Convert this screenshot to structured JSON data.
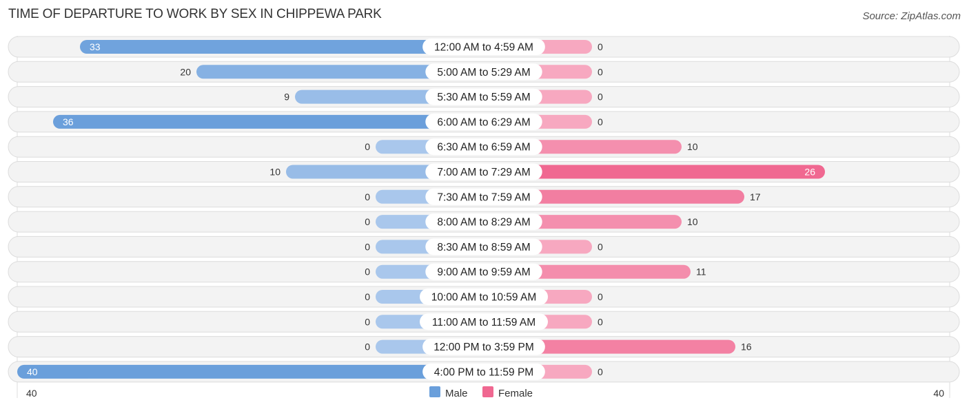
{
  "title": "TIME OF DEPARTURE TO WORK BY SEX IN CHIPPEWA PARK",
  "source": "Source: ZipAtlas.com",
  "colors": {
    "male": "#6a9fdb",
    "male_light": "#a9c7ec",
    "female": "#f06891",
    "female_light": "#f7a8c0",
    "row_bg": "#f2f2f2"
  },
  "chart_data": {
    "type": "bar",
    "orientation": "horizontal-diverging",
    "title": "TIME OF DEPARTURE TO WORK BY SEX IN CHIPPEWA PARK",
    "categories": [
      "12:00 AM to 4:59 AM",
      "5:00 AM to 5:29 AM",
      "5:30 AM to 5:59 AM",
      "6:00 AM to 6:29 AM",
      "6:30 AM to 6:59 AM",
      "7:00 AM to 7:29 AM",
      "7:30 AM to 7:59 AM",
      "8:00 AM to 8:29 AM",
      "8:30 AM to 8:59 AM",
      "9:00 AM to 9:59 AM",
      "10:00 AM to 10:59 AM",
      "11:00 AM to 11:59 AM",
      "12:00 PM to 3:59 PM",
      "4:00 PM to 11:59 PM"
    ],
    "series": [
      {
        "name": "Male",
        "values": [
          33,
          20,
          9,
          36,
          0,
          10,
          0,
          0,
          0,
          0,
          0,
          0,
          0,
          40
        ]
      },
      {
        "name": "Female",
        "values": [
          0,
          0,
          0,
          0,
          10,
          26,
          17,
          10,
          0,
          11,
          0,
          0,
          16,
          0
        ]
      }
    ],
    "axis": {
      "left_label": "40",
      "right_label": "40",
      "max": 40
    },
    "legend": {
      "position": "bottom-center",
      "entries": [
        "Male",
        "Female"
      ]
    }
  }
}
